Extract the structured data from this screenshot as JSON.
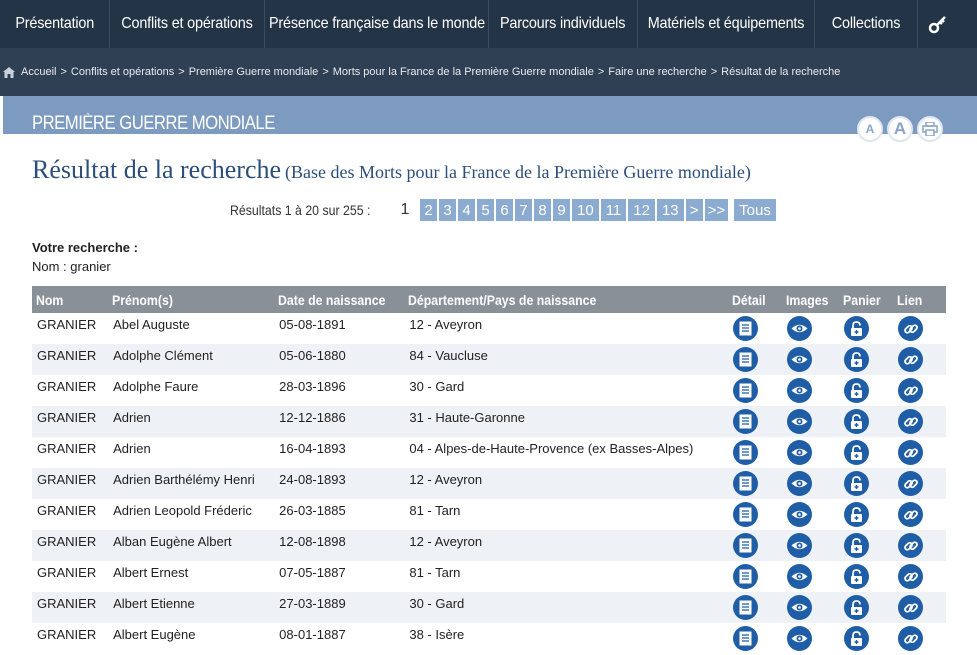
{
  "nav": {
    "items": [
      "Présentation",
      "Conflits et opérations",
      "Présence française dans le monde",
      "Parcours individuels",
      "Matériels et équipements",
      "Collections"
    ]
  },
  "breadcrumb": [
    "Accueil",
    "Conflits et opérations",
    "Première Guerre mondiale",
    "Morts pour la France de la Première Guerre mondiale",
    "Faire une recherche",
    "Résultat de la recherche"
  ],
  "section": {
    "title": "PREMIÈRE GUERRE MONDIALE",
    "font_small": "A",
    "font_large": "A"
  },
  "page": {
    "title": "Résultat de la recherche",
    "subtitle": "(Base des Morts pour la France de la Première Guerre mondiale)"
  },
  "pagination": {
    "summary": "Résultats 1 à 20 sur 255 :",
    "current": "1",
    "pages": [
      "2",
      "3",
      "4",
      "5",
      "6",
      "7",
      "8",
      "9",
      "10",
      "11",
      "12",
      "13"
    ],
    "next": ">",
    "last": ">>",
    "all": "Tous"
  },
  "search": {
    "label": "Votre recherche :",
    "criteria": "Nom : granier"
  },
  "table": {
    "headers": [
      "Nom",
      "Prénom(s)",
      "Date de naissance",
      "Département/Pays de naissance",
      "Détail",
      "Images",
      "Panier",
      "Lien"
    ],
    "rows": [
      [
        "GRANIER",
        "Abel Auguste",
        "05-08-1891",
        "12 - Aveyron"
      ],
      [
        "GRANIER",
        "Adolphe Clément",
        "05-06-1880",
        "84 - Vaucluse"
      ],
      [
        "GRANIER",
        "Adolphe Faure",
        "28-03-1896",
        "30 - Gard"
      ],
      [
        "GRANIER",
        "Adrien",
        "12-12-1886",
        "31 - Haute-Garonne"
      ],
      [
        "GRANIER",
        "Adrien",
        "16-04-1893",
        "04 - Alpes-de-Haute-Provence (ex Basses-Alpes)"
      ],
      [
        "GRANIER",
        "Adrien Barthélémy Henri",
        "24-08-1893",
        "12 - Aveyron"
      ],
      [
        "GRANIER",
        "Adrien Leopold Fréderic",
        "26-03-1885",
        "81 - Tarn"
      ],
      [
        "GRANIER",
        "Alban Eugène Albert",
        "12-08-1898",
        "12 - Aveyron"
      ],
      [
        "GRANIER",
        "Albert Ernest",
        "07-05-1887",
        "81 - Tarn"
      ],
      [
        "GRANIER",
        "Albert Etienne",
        "27-03-1889",
        "30 - Gard"
      ],
      [
        "GRANIER",
        "Albert Eugène",
        "08-01-1887",
        "38 - Isère"
      ]
    ]
  },
  "colors": {
    "nav_bg": "#243447",
    "crumb_bg": "#2f4054",
    "band": "#7d9bc0",
    "title": "#2b4e7a",
    "icon": "#1f5ea6",
    "page_btn": "#8cabd0"
  }
}
